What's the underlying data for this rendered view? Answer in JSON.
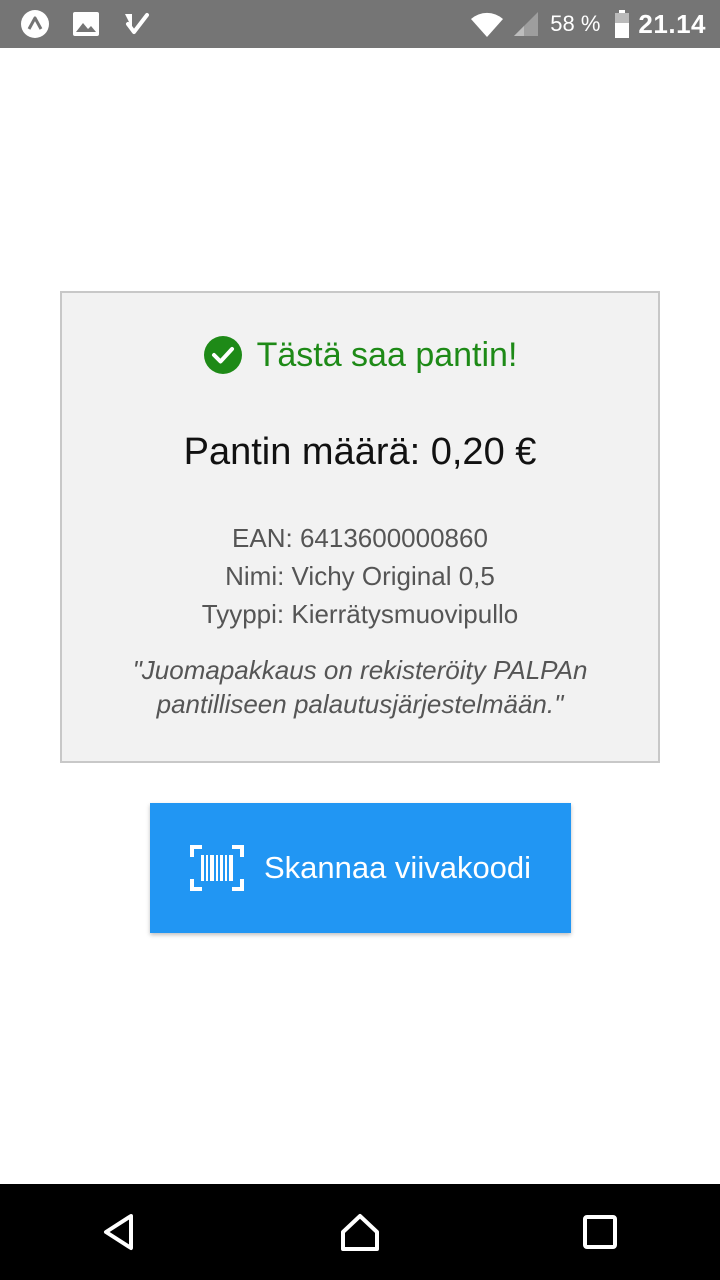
{
  "status_bar": {
    "battery_percent": "58 %",
    "time": "21.14",
    "left_icons": [
      "expo-icon",
      "image-icon",
      "tasks-check-icon"
    ],
    "right_icons": [
      "wifi-icon",
      "signal-icon",
      "battery-icon"
    ]
  },
  "result": {
    "status_text": "Tästä saa pantin!",
    "amount_text": "Pantin määrä: 0,20 €",
    "ean_text": "EAN: 6413600000860",
    "name_text": "Nimi: Vichy Original 0,5",
    "type_text": "Tyyppi: Kierrätysmuovipullo",
    "quote_line1": "\"Juomapakkaus on rekisteröity PALPAn",
    "quote_line2": "pantilliseen palautusjärjestelmään.\"",
    "status_color": "#1e8a17"
  },
  "scan_button": {
    "label": "Skannaa viivakoodi",
    "icon": "barcode-scan-icon",
    "color": "#2196f3"
  },
  "nav_bar": {
    "buttons": [
      "back-icon",
      "home-icon",
      "recents-icon"
    ]
  }
}
